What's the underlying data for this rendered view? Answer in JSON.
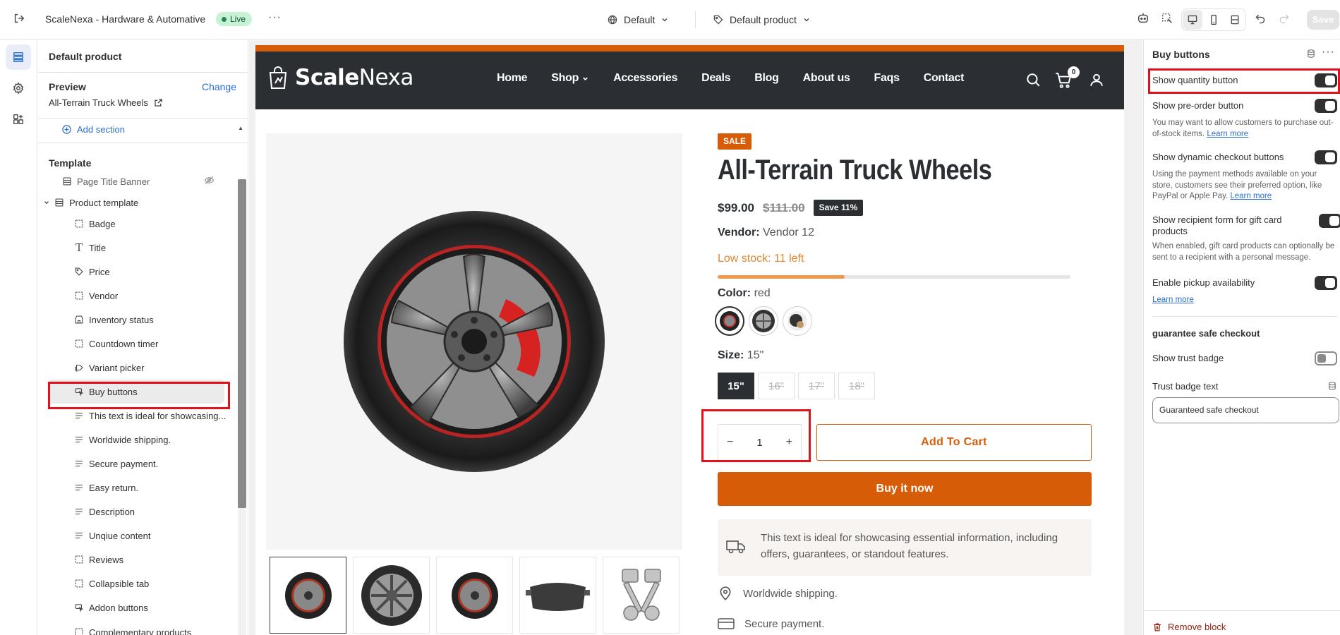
{
  "topbar": {
    "store_name": "ScaleNexa - Hardware & Automative",
    "status": "Live",
    "more": "···",
    "theme": "Default",
    "template": "Default product",
    "save": "Save"
  },
  "left_panel": {
    "title": "Default product",
    "preview_label": "Preview",
    "change_link": "Change",
    "preview_product": "All-Terrain Truck Wheels",
    "add_section": "Add section",
    "template_label": "Template",
    "items": [
      {
        "label": "Page Title Banner",
        "icon": "section-icon"
      },
      {
        "label": "Product template",
        "icon": "section-icon"
      },
      {
        "label": "Badge",
        "icon": "block-icon"
      },
      {
        "label": "Title",
        "icon": "text-icon"
      },
      {
        "label": "Price",
        "icon": "price-tag-icon"
      },
      {
        "label": "Vendor",
        "icon": "block-icon"
      },
      {
        "label": "Inventory status",
        "icon": "store-icon"
      },
      {
        "label": "Countdown timer",
        "icon": "block-icon"
      },
      {
        "label": "Variant picker",
        "icon": "variant-icon"
      },
      {
        "label": "Buy buttons",
        "icon": "cursor-icon"
      },
      {
        "label": "This text is ideal for showcasing...",
        "icon": "lines-icon"
      },
      {
        "label": "Worldwide shipping.",
        "icon": "lines-icon"
      },
      {
        "label": "Secure payment.",
        "icon": "lines-icon"
      },
      {
        "label": "Easy return.",
        "icon": "lines-icon"
      },
      {
        "label": "Description",
        "icon": "lines-icon"
      },
      {
        "label": "Unqiue content",
        "icon": "lines-icon"
      },
      {
        "label": "Reviews",
        "icon": "block-icon"
      },
      {
        "label": "Collapsible tab",
        "icon": "block-icon"
      },
      {
        "label": "Addon buttons",
        "icon": "cursor-icon"
      },
      {
        "label": "Complementary products",
        "icon": "block-icon"
      }
    ]
  },
  "store": {
    "logo_bold": "Scale",
    "logo_light": "Nexa",
    "nav": [
      "Home",
      "Shop",
      "Accessories",
      "Deals",
      "Blog",
      "About us",
      "Faqs",
      "Contact"
    ],
    "cart_count": "0",
    "badge": "SALE",
    "title": "All-Terrain Truck Wheels",
    "price": "$99.00",
    "compare_price": "$111.00",
    "save": "Save 11%",
    "vendor_label": "Vendor:",
    "vendor": "Vendor 12",
    "low_stock": "Low stock: 11 left",
    "stock_level": 0.36,
    "color_label": "Color:",
    "color_value": "red",
    "size_label": "Size:",
    "size_value": "15\"",
    "sizes": [
      "15\"",
      "16\"",
      "17\"",
      "18\""
    ],
    "qty": "1",
    "qty_minus": "−",
    "qty_plus": "+",
    "add_to_cart": "Add To Cart",
    "buy_now": "Buy it now",
    "info_text": "This text is ideal for showcasing essential information, including offers, guarantees, or standout features.",
    "feature_shipping": "Worldwide shipping.",
    "feature_payment": "Secure payment.",
    "accent": "#d65c07",
    "nav_bg": "#2b2f34"
  },
  "right_panel": {
    "title": "Buy buttons",
    "show_quantity": "Show quantity button",
    "show_preorder": "Show pre-order button",
    "preorder_help": "You may want to allow customers to purchase out-of-stock items.",
    "learn_more": "Learn more",
    "show_dynamic": "Show dynamic checkout buttons",
    "dynamic_help": "Using the payment methods available on your store, customers see their preferred option, like PayPal or Apple Pay.",
    "show_recipient": "Show recipient form for gift card products",
    "recipient_help": "When enabled, gift card products can optionally be sent to a recipient with a personal message.",
    "enable_pickup": "Enable pickup availability",
    "guarantee_heading": "guarantee safe checkout",
    "show_trust": "Show trust badge",
    "trust_text_label": "Trust badge text",
    "trust_text_value": "Guaranteed safe checkout",
    "remove_block": "Remove block"
  }
}
